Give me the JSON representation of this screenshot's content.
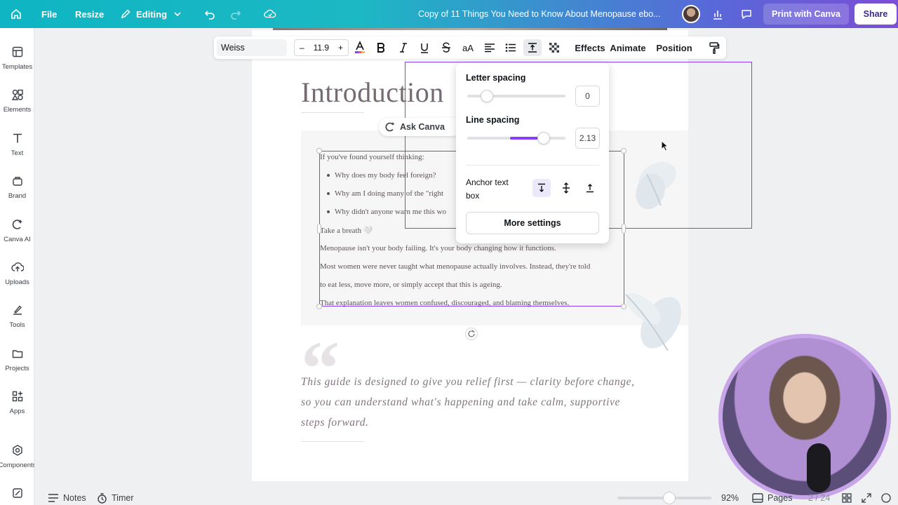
{
  "topbar": {
    "file_label": "File",
    "resize_label": "Resize",
    "editing_label": "Editing",
    "document_title": "Copy of 11 Things You Need to Know About Menopause ebo...",
    "print_label": "Print with Canva",
    "share_label": "Share"
  },
  "sidebar": {
    "items": [
      {
        "label": "Templates",
        "icon": "templates-icon"
      },
      {
        "label": "Elements",
        "icon": "elements-icon"
      },
      {
        "label": "Text",
        "icon": "text-icon"
      },
      {
        "label": "Brand",
        "icon": "brand-icon"
      },
      {
        "label": "Canva AI",
        "icon": "canva-ai-icon"
      },
      {
        "label": "Uploads",
        "icon": "uploads-icon"
      },
      {
        "label": "Tools",
        "icon": "tools-icon"
      },
      {
        "label": "Projects",
        "icon": "projects-icon"
      },
      {
        "label": "Apps",
        "icon": "apps-icon"
      },
      {
        "label": "Components",
        "icon": "components-icon"
      }
    ]
  },
  "toolbar": {
    "font": "Weiss",
    "size_minus": "–",
    "font_size": "11.9",
    "size_plus": "+",
    "case_label": "aA",
    "effects_label": "Effects",
    "animate_label": "Animate",
    "position_label": "Position"
  },
  "ask_canva": {
    "label": "Ask Canva"
  },
  "spacing_popover": {
    "letter_spacing_label": "Letter spacing",
    "letter_spacing_value": "0",
    "letter_spacing_level": 0.2,
    "line_spacing_label": "Line spacing",
    "line_spacing_value": "2.13",
    "line_spacing_level": 0.78,
    "anchor_label": "Anchor text box",
    "more_settings_label": "More settings"
  },
  "page": {
    "heading": "Introduction",
    "body_lines": [
      "If you've found yourself thinking:",
      "Why does my body feel foreign?",
      "Why am I doing many of the \"right",
      "Why didn't anyone warn me this wo",
      "Take a breath 🤍",
      "Menopause isn't your body failing. It's your body changing how it functions.",
      "Most women were never taught what menopause actually involves. Instead, they're told",
      "to eat less, move more, or simply accept that this is ageing.",
      "That explanation leaves women confused, discouraged, and blaming themselves."
    ],
    "quote_lines": [
      "This guide is designed to give you relief first — clarity before change,",
      "so you can understand what's happening and take calm, supportive",
      "steps forward."
    ]
  },
  "bottom_bar": {
    "notes_label": "Notes",
    "timer_label": "Timer",
    "zoom_label": "92%",
    "zoom_level": 0.55,
    "pages_label": "Pages",
    "page_counter": "2 / 24"
  },
  "colors": {
    "accent": "#8b3dff",
    "topbar_start": "#0fb5c3",
    "topbar_end": "#7b4fd6"
  }
}
